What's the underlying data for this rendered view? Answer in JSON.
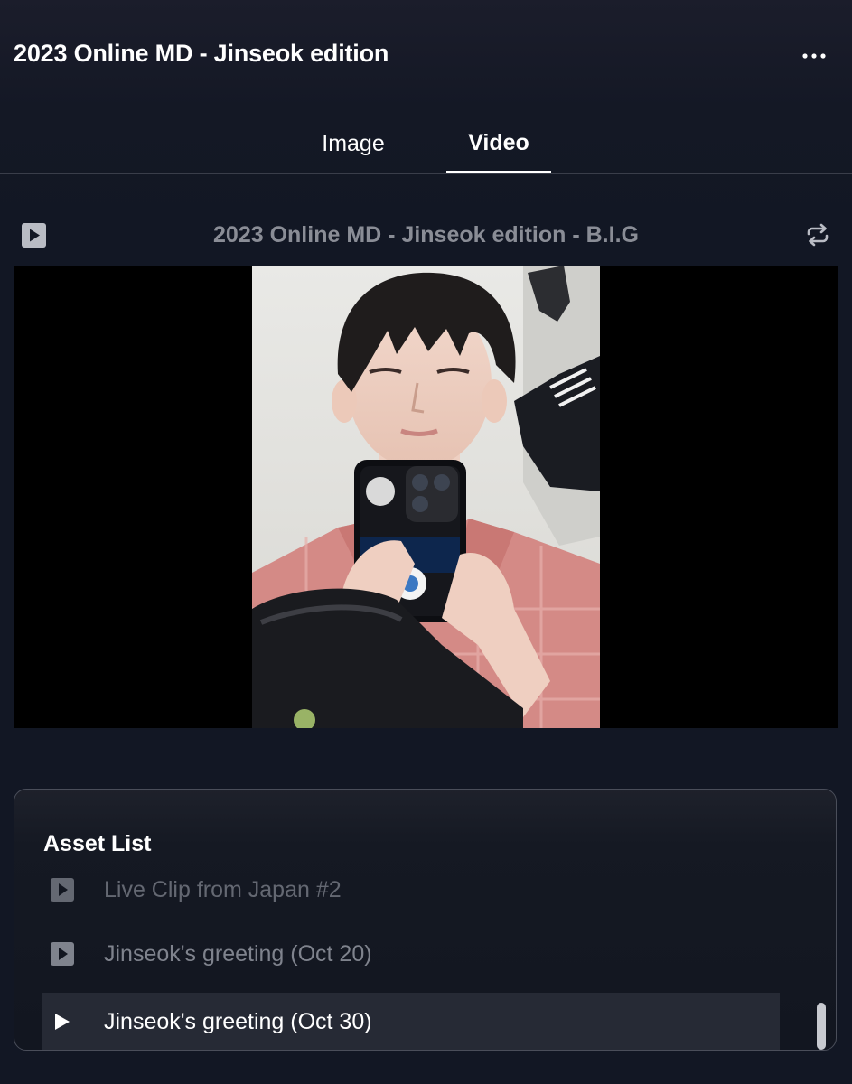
{
  "header": {
    "title": "2023 Online MD - Jinseok edition",
    "more_icon": "ellipsis-icon"
  },
  "tabs": [
    {
      "label": "Image",
      "active": false
    },
    {
      "label": "Video",
      "active": true
    }
  ],
  "player": {
    "type_icon": "play-square-icon",
    "title": "2023 Online MD - Jinseok edition - B.I.G",
    "repeat_icon": "repeat-icon",
    "thumbnail": "photo-of-person-taking-mirror-selfie"
  },
  "asset_list": {
    "title": "Asset List",
    "items": [
      {
        "label": "Live Clip from Japan #2",
        "state": "partially-visible"
      },
      {
        "label": "Jinseok's greeting (Oct 20)",
        "state": "inactive"
      },
      {
        "label": "Jinseok's greeting (Oct 30)",
        "state": "active"
      }
    ]
  },
  "colors": {
    "background": "#121724",
    "muted_text": "#7f838d",
    "player_title": "#8a8d96",
    "active_row": "#262a35",
    "video_bg": "#000000"
  }
}
